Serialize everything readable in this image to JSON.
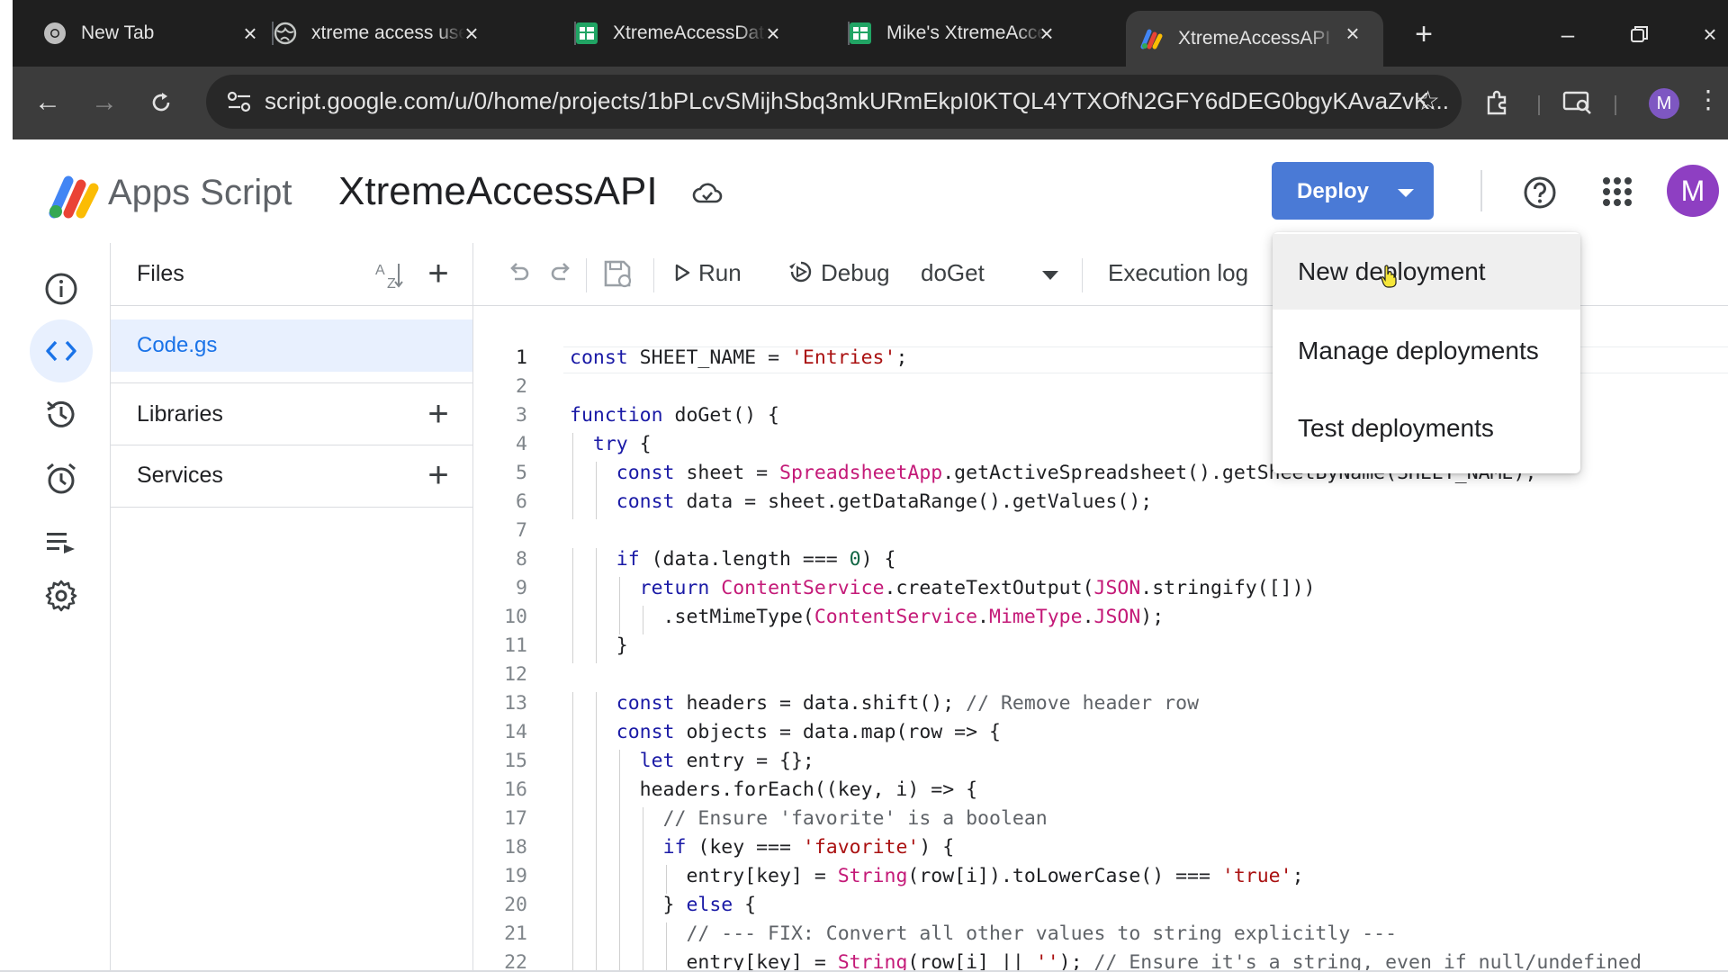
{
  "browser": {
    "tabs": [
      {
        "title": "New Tab",
        "icon": "chrome-icon"
      },
      {
        "title": "xtreme access user",
        "icon": "globe-icon"
      },
      {
        "title": "XtremeAccessData",
        "icon": "sheets-icon"
      },
      {
        "title": "Mike's XtremeAcce",
        "icon": "sheets-icon"
      },
      {
        "title": "XtremeAccessAPI - ",
        "icon": "apps-script-icon"
      }
    ],
    "url": "script.google.com/u/0/home/projects/1bPLcvSMijhSbq3mkURmEkpI0KTQL4YTXOfN2GFY6dDEG0bgyKAvaZvK...",
    "profile_initial": "M"
  },
  "header": {
    "product": "Apps Script",
    "project": "XtremeAccessAPI",
    "deploy_label": "Deploy",
    "avatar_initial": "M",
    "colors": {
      "deploy_button": "#4a7ad6",
      "avatar": "#8e3fc2"
    }
  },
  "files_panel": {
    "files_label": "Files",
    "files": [
      "Code.gs"
    ],
    "libraries_label": "Libraries",
    "services_label": "Services"
  },
  "editor_toolbar": {
    "run_label": "Run",
    "debug_label": "Debug",
    "function": "doGet",
    "execution_log_label": "Execution log"
  },
  "deploy_menu": {
    "items": [
      "New deployment",
      "Manage deployments",
      "Test deployments"
    ],
    "hovered": "New deployment"
  },
  "code": {
    "current_line": 1,
    "lines": [
      "const SHEET_NAME = 'Entries';",
      "",
      "function doGet() {",
      "  try {",
      "    const sheet = SpreadsheetApp.getActiveSpreadsheet().getSheetByName(SHEET_NAME);",
      "    const data = sheet.getDataRange().getValues();",
      "",
      "    if (data.length === 0) {",
      "      return ContentService.createTextOutput(JSON.stringify([]))",
      "        .setMimeType(ContentService.MimeType.JSON);",
      "    }",
      "",
      "    const headers = data.shift(); // Remove header row",
      "    const objects = data.map(row => {",
      "      let entry = {};",
      "      headers.forEach((key, i) => {",
      "        // Ensure 'favorite' is a boolean",
      "        if (key === 'favorite') {",
      "          entry[key] = String(row[i]).toLowerCase() === 'true';",
      "        } else {",
      "          // --- FIX: Convert all other values to string explicitly ---",
      "          entry[key] = String(row[i] || ''); // Ensure it's a string, even if null/undefined"
    ]
  }
}
